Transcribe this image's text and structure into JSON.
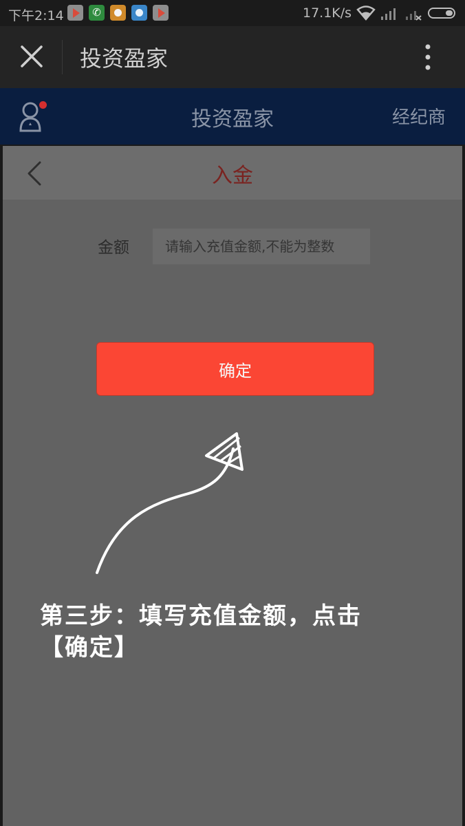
{
  "status_bar": {
    "time": "下午2:14",
    "net_speed": "17.1K/s",
    "notification_icons": [
      "play-store-icon",
      "phone-icon",
      "orange-app-icon",
      "blue-app-icon",
      "play-store-icon"
    ]
  },
  "webview": {
    "title": "投资盈家"
  },
  "app_header": {
    "title": "投资盈家",
    "broker_label": "经纪商"
  },
  "page": {
    "title": "入金",
    "amount_label": "金额",
    "amount_placeholder": "请输入充值金额,不能为整数",
    "amount_value": "",
    "confirm_label": "确定"
  },
  "tutorial": {
    "line1": "第三步：填写充值金额，点击",
    "line2": "【确定】"
  },
  "colors": {
    "header_bg": "#0a1e40",
    "confirm_bg": "#fb4634",
    "page_title": "#7a2320",
    "overlay_bg": "#626262"
  }
}
